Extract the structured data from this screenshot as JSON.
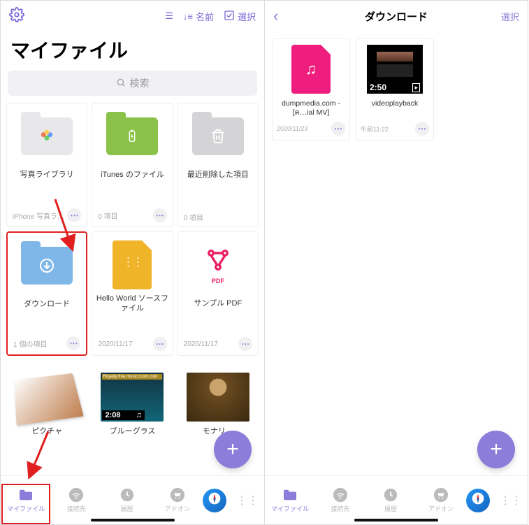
{
  "left": {
    "header": {
      "sort_label": "名前",
      "select_label": "選択"
    },
    "title": "マイファイル",
    "search_placeholder": "検索",
    "tiles": [
      {
        "label": "写真ライブラリ",
        "meta": "iPhone 写真ラ…"
      },
      {
        "label": "iTunes のファイル",
        "meta": "0 項目"
      },
      {
        "label": "最近削除した項目",
        "meta": "0 項目"
      },
      {
        "label": "ダウンロード",
        "meta": "1 個の項目"
      },
      {
        "label": "Hello World ソースファイル",
        "meta": "2020/11/17"
      },
      {
        "label": "サンプル PDF",
        "meta": "2020/11/17"
      },
      {
        "label": "ピクチャ",
        "meta": ""
      },
      {
        "label": "ブルーグラス",
        "meta": "",
        "duration": "2:08"
      },
      {
        "label": "モナリ…",
        "meta": ""
      }
    ],
    "tabs": [
      "マイファイル",
      "接続先",
      "履歴",
      "アドオン"
    ]
  },
  "right": {
    "title": "ダウンロード",
    "select_label": "選択",
    "tiles": [
      {
        "label": "dumpmedia.com - [ค…ial MV]",
        "meta": "2020/11/23"
      },
      {
        "label": "videoplayback",
        "meta": "午前11:22",
        "duration": "2:50"
      }
    ],
    "tabs": [
      "マイファイル",
      "接続先",
      "履歴",
      "アドオン"
    ]
  }
}
